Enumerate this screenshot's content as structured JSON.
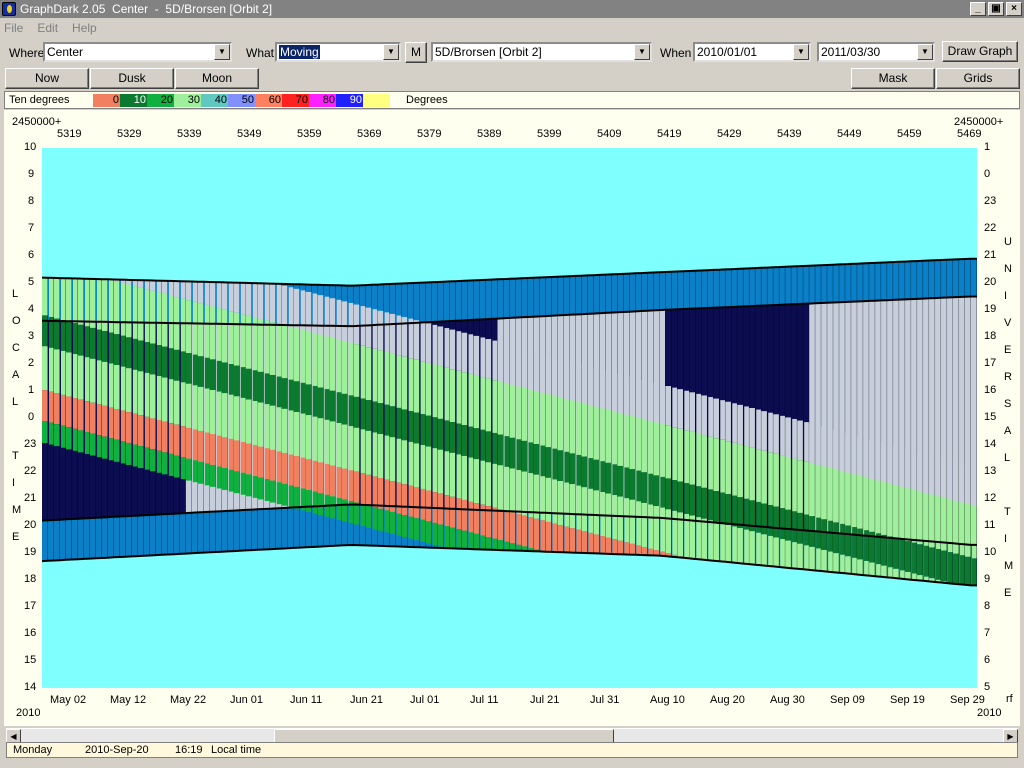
{
  "window": {
    "title": "GraphDark 2.05  Center  -  5D/Brorsen [Orbit 2]",
    "icon": "moon-app-icon",
    "buttons": [
      "_",
      "▣",
      "×"
    ]
  },
  "menu": [
    "File",
    "Edit",
    "Help"
  ],
  "toolbar": {
    "where_label": "Where",
    "where_value": "Center",
    "what_label": "What",
    "what_value": "Moving",
    "m_button": "M",
    "object_value": "5D/Brorsen [Orbit 2]",
    "when_label": "When",
    "date_from": "2010/01/01",
    "date_to": "2011/03/30",
    "draw_button": "Draw Graph"
  },
  "toolbar2": {
    "now": "Now",
    "dusk": "Dusk",
    "moon": "Moon",
    "mask": "Mask",
    "grids": "Grids"
  },
  "legend": {
    "label": "Ten degrees",
    "units": "Degrees",
    "items": [
      {
        "label": "0",
        "color": "#f08060"
      },
      {
        "label": "10",
        "color": "#0c7a2e"
      },
      {
        "label": "20",
        "color": "#10b040"
      },
      {
        "label": "30",
        "color": "#9ff09a"
      },
      {
        "label": "40",
        "color": "#60c8c0"
      },
      {
        "label": "50",
        "color": "#8090ff"
      },
      {
        "label": "60",
        "color": "#ff8060"
      },
      {
        "label": "70",
        "color": "#ff2020"
      },
      {
        "label": "80",
        "color": "#ff20ff"
      },
      {
        "label": "90",
        "color": "#2020ff"
      },
      {
        "label": "",
        "color": "#ffff80"
      }
    ]
  },
  "colors": {
    "sky_day": "#80ffff",
    "twilight": "#0a80c8",
    "night_no_object": "#c8cfdc",
    "moon_dark": "#0c0c50"
  },
  "chart_data": {
    "type": "heatmap",
    "title": "",
    "top_axis_prefix_left": "2450000+",
    "top_axis_prefix_right": "2450000+",
    "top_axis_ticks": [
      "5319",
      "5329",
      "5339",
      "5349",
      "5359",
      "5369",
      "5379",
      "5389",
      "5399",
      "5409",
      "5419",
      "5429",
      "5439",
      "5449",
      "5459",
      "5469"
    ],
    "bottom_axis_ticks": [
      "May 02",
      "May 12",
      "May 22",
      "Jun 01",
      "Jun 11",
      "Jun 21",
      "Jul 01",
      "Jul 11",
      "Jul 21",
      "Jul 31",
      "Aug 10",
      "Aug 20",
      "Aug 30",
      "Sep 09",
      "Sep 19",
      "Sep 29"
    ],
    "bottom_axis_year_left": "2010",
    "bottom_axis_year_right": "2010",
    "bottom_axis_right_extra": "rf",
    "left_axis_label": "LOCAL TIME",
    "right_axis_label": "UNIVERSAL TIME",
    "left_ticks": [
      "10",
      "9",
      "8",
      "7",
      "6",
      "5",
      "4",
      "3",
      "2",
      "1",
      "0",
      "23",
      "22",
      "21",
      "20",
      "19",
      "18",
      "17",
      "16",
      "15",
      "14"
    ],
    "right_ticks": [
      "1",
      "0",
      "23",
      "22",
      "21",
      "20",
      "19",
      "18",
      "17",
      "16",
      "15",
      "14",
      "13",
      "12",
      "11",
      "10",
      "9",
      "8",
      "7",
      "6",
      "5"
    ],
    "dusk_start_hours": [
      18.7,
      19.3,
      18.9,
      17.8
    ],
    "dawn_end_hours": [
      5.2,
      4.9,
      5.4,
      5.9
    ],
    "night_start_hours": [
      20.2,
      20.8,
      20.3,
      19.3
    ],
    "night_end_hours": [
      3.6,
      3.4,
      4.0,
      4.5
    ],
    "x_range_dates": [
      "2010-04-28",
      "2010-10-01"
    ]
  },
  "status": {
    "day": "Monday",
    "date": "2010-Sep-20",
    "time": "16:19",
    "zone": "Local time"
  }
}
